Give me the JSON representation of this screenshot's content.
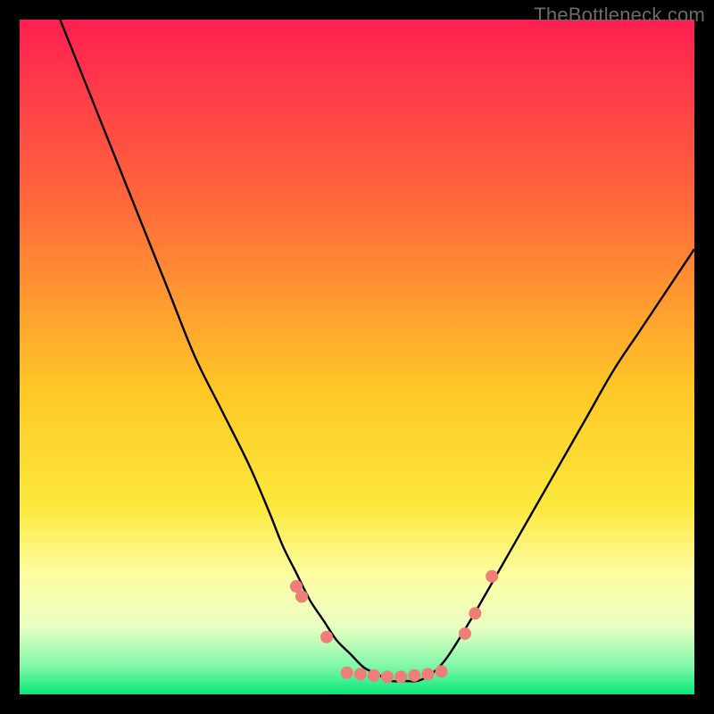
{
  "watermark": "TheBottleneck.com",
  "chart_data": {
    "type": "line",
    "title": "",
    "xlabel": "",
    "ylabel": "",
    "xlim": [
      0,
      100
    ],
    "ylim": [
      0,
      100
    ],
    "grid": false,
    "legend": false,
    "background_gradient_stops": [
      {
        "offset": 0.0,
        "color": "#ff1f52"
      },
      {
        "offset": 0.28,
        "color": "#ff6b3a"
      },
      {
        "offset": 0.55,
        "color": "#ffc827"
      },
      {
        "offset": 0.72,
        "color": "#fbe83b"
      },
      {
        "offset": 0.82,
        "color": "#fdfca0"
      },
      {
        "offset": 0.9,
        "color": "#e9ffc3"
      },
      {
        "offset": 0.96,
        "color": "#7cf7a7"
      },
      {
        "offset": 1.0,
        "color": "#06e67b"
      }
    ],
    "series": [
      {
        "name": "curve",
        "x": [
          6,
          10,
          14,
          18,
          22,
          26,
          30,
          34,
          37,
          39,
          41,
          43,
          45,
          47,
          49,
          51,
          53,
          55,
          57,
          59,
          61,
          63,
          65,
          68,
          72,
          76,
          80,
          84,
          88,
          92,
          96,
          100
        ],
        "y": [
          100,
          90,
          80,
          70,
          60,
          50,
          42,
          34,
          27,
          22,
          18,
          14,
          11,
          8,
          6,
          4,
          3,
          2,
          2,
          2,
          3,
          5,
          8,
          13,
          20,
          27,
          34,
          41,
          48,
          54,
          60,
          66
        ]
      }
    ],
    "markers": [
      {
        "x": 41.0,
        "y": 16.0
      },
      {
        "x": 41.8,
        "y": 14.5
      },
      {
        "x": 45.5,
        "y": 8.5
      },
      {
        "x": 48.5,
        "y": 3.2
      },
      {
        "x": 50.5,
        "y": 3.0
      },
      {
        "x": 52.5,
        "y": 2.8
      },
      {
        "x": 54.5,
        "y": 2.6
      },
      {
        "x": 56.5,
        "y": 2.6
      },
      {
        "x": 58.5,
        "y": 2.8
      },
      {
        "x": 60.5,
        "y": 3.0
      },
      {
        "x": 62.5,
        "y": 3.4
      },
      {
        "x": 66.0,
        "y": 9.0
      },
      {
        "x": 67.5,
        "y": 12.0
      },
      {
        "x": 70.0,
        "y": 17.5
      }
    ],
    "marker_style": {
      "radius": 7,
      "fill": "#ef7d78"
    }
  }
}
